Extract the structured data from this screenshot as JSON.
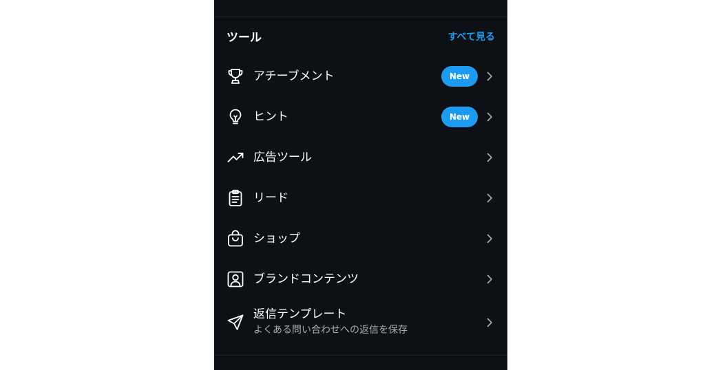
{
  "section": {
    "title": "ツール",
    "see_all": "すべて見る"
  },
  "items": [
    {
      "label": "アチーブメント",
      "badge": "New",
      "icon": "trophy-icon"
    },
    {
      "label": "ヒント",
      "badge": "New",
      "icon": "lightbulb-icon"
    },
    {
      "label": "広告ツール",
      "icon": "trending-up-icon"
    },
    {
      "label": "リード",
      "icon": "clipboard-icon"
    },
    {
      "label": "ショップ",
      "icon": "shopping-bag-icon"
    },
    {
      "label": "ブランドコンテンツ",
      "icon": "person-frame-icon"
    },
    {
      "label": "返信テンプレート",
      "sublabel": "よくある問い合わせへの返信を保存",
      "icon": "paper-plane-icon"
    }
  ],
  "colors": {
    "background": "#0d1015",
    "accent": "#1d9bf0",
    "secondary_text": "#a7adb3"
  }
}
